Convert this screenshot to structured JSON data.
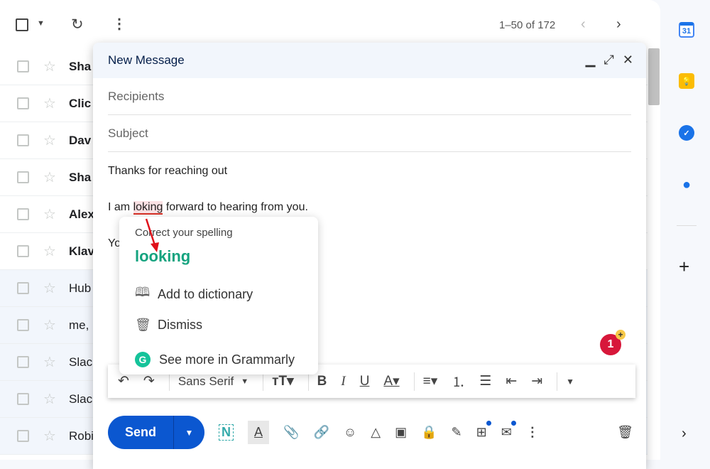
{
  "toolbar": {
    "pagination": "1–50 of 172"
  },
  "inbox": {
    "rows": [
      {
        "sender": "Sha",
        "read": false
      },
      {
        "sender": "Clic",
        "read": false
      },
      {
        "sender": "Dav",
        "read": false
      },
      {
        "sender": "Sha",
        "read": false
      },
      {
        "sender": "Alex",
        "read": false
      },
      {
        "sender": "Klav",
        "read": false
      },
      {
        "sender": "Hub",
        "read": true
      },
      {
        "sender": "me,",
        "read": true
      },
      {
        "sender": "Slac",
        "read": true
      },
      {
        "sender": "Slac",
        "read": true
      },
      {
        "sender": "Robi",
        "read": true
      }
    ]
  },
  "compose": {
    "title": "New Message",
    "recipients_placeholder": "Recipients",
    "subject_placeholder": "Subject",
    "body": {
      "line1": "Thanks for reaching out",
      "line2_pre": "I am ",
      "misspelled": "loking",
      "line2_post": " forward to hearing from you.",
      "line3": "Yo"
    },
    "font": "Sans Serif",
    "send_label": "Send"
  },
  "grammarly": {
    "title": "Correct your spelling",
    "suggestion": "looking",
    "add_to_dictionary": "Add to dictionary",
    "dismiss": "Dismiss",
    "see_more": "See more in Grammarly",
    "badge_count": "1",
    "brand_color": "#15c39a"
  },
  "sidebar": {
    "calendar_day": "31"
  }
}
